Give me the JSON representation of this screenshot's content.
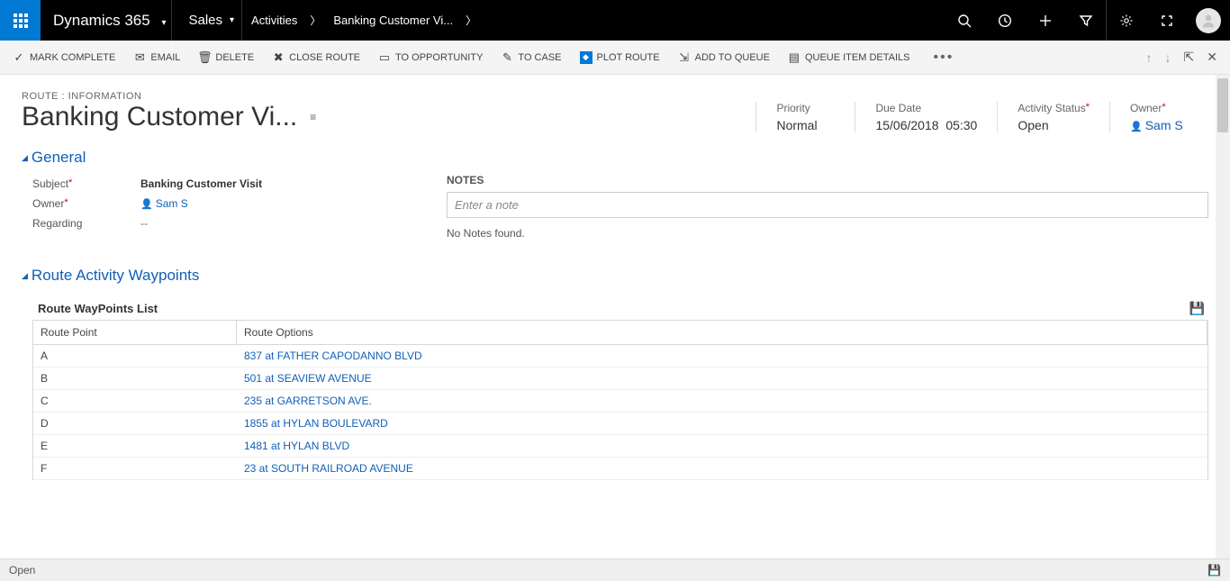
{
  "topbar": {
    "brand": "Dynamics 365",
    "area": "Sales",
    "crumb1": "Activities",
    "crumb2": "Banking Customer Vi..."
  },
  "commands": {
    "mark_complete": "MARK COMPLETE",
    "email": "EMAIL",
    "delete": "DELETE",
    "close_route": "CLOSE ROUTE",
    "to_opportunity": "TO OPPORTUNITY",
    "to_case": "TO CASE",
    "plot_route": "PLOT ROUTE",
    "add_to_queue": "ADD TO QUEUE",
    "queue_item_details": "QUEUE ITEM DETAILS"
  },
  "record": {
    "form_label": "ROUTE : INFORMATION",
    "title": "Banking Customer Vi...",
    "priority_label": "Priority",
    "priority_value": "Normal",
    "due_date_label": "Due Date",
    "due_date": "15/06/2018",
    "due_time": "05:30",
    "activity_status_label": "Activity Status",
    "activity_status_value": "Open",
    "owner_label": "Owner",
    "owner_value": "Sam S"
  },
  "sections": {
    "general": "General",
    "waypoints": "Route Activity Waypoints"
  },
  "general": {
    "subject_label": "Subject",
    "subject_value": "Banking Customer Visit",
    "owner_label": "Owner",
    "owner_value": "Sam S",
    "regarding_label": "Regarding",
    "regarding_value": "--"
  },
  "notes": {
    "label": "NOTES",
    "placeholder": "Enter a note",
    "empty": "No Notes found."
  },
  "waypoints": {
    "list_title": "Route WayPoints List",
    "col_point": "Route Point",
    "col_options": "Route Options",
    "rows": [
      {
        "p": "A",
        "o": "837 at FATHER CAPODANNO BLVD"
      },
      {
        "p": "B",
        "o": "501 at SEAVIEW AVENUE"
      },
      {
        "p": "C",
        "o": "235 at GARRETSON AVE."
      },
      {
        "p": "D",
        "o": "1855 at HYLAN BOULEVARD"
      },
      {
        "p": "E",
        "o": "1481 at HYLAN BLVD"
      },
      {
        "p": "F",
        "o": "23 at SOUTH RAILROAD AVENUE"
      }
    ]
  },
  "footer": {
    "status": "Open"
  }
}
